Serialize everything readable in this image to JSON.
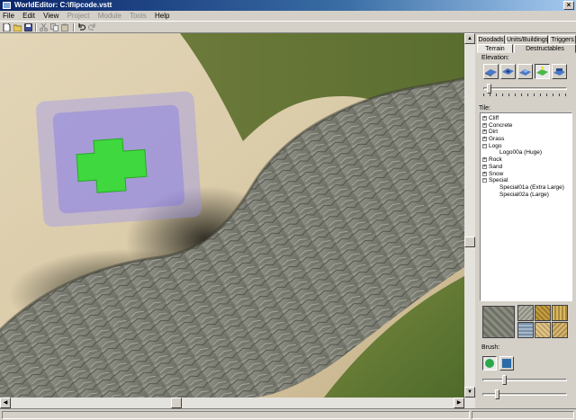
{
  "window": {
    "title": "WorldEditor: C:\\flipcode.vstt",
    "close_glyph": "×"
  },
  "menu": [
    {
      "label": "File",
      "enabled": true
    },
    {
      "label": "Edit",
      "enabled": true
    },
    {
      "label": "View",
      "enabled": true
    },
    {
      "label": "Project",
      "enabled": false
    },
    {
      "label": "Module",
      "enabled": false
    },
    {
      "label": "Tools",
      "enabled": false
    },
    {
      "label": "Help",
      "enabled": true
    }
  ],
  "toolbar": {
    "buttons": [
      "new-file-icon",
      "open-folder-icon",
      "save-icon",
      "cut-icon",
      "copy-icon",
      "paste-icon",
      "undo-icon",
      "redo-icon"
    ]
  },
  "tabs": {
    "row1": [
      "Doodads",
      "Units/Buildings",
      "Triggers"
    ],
    "row2": [
      "Terrain",
      "Destructables"
    ],
    "active": "Terrain"
  },
  "elevation": {
    "label": "Elevation:",
    "selected_index": 3,
    "slider_level": 0.05
  },
  "tiles": {
    "label": "Tile:",
    "tree": [
      {
        "label": "Cliff",
        "type": "parent",
        "expanded": false
      },
      {
        "label": "Concrete",
        "type": "parent",
        "expanded": false
      },
      {
        "label": "Dirt",
        "type": "parent",
        "expanded": false
      },
      {
        "label": "Grass",
        "type": "parent",
        "expanded": false
      },
      {
        "label": "Logo",
        "type": "parent",
        "expanded": true
      },
      {
        "label": "Logo00a (Huge)",
        "type": "child"
      },
      {
        "label": "Rock",
        "type": "parent",
        "expanded": false
      },
      {
        "label": "Sand",
        "type": "parent",
        "expanded": false
      },
      {
        "label": "Snow",
        "type": "parent",
        "expanded": false
      },
      {
        "label": "Special",
        "type": "parent",
        "expanded": true
      },
      {
        "label": "Special01a (Extra Large)",
        "type": "child"
      },
      {
        "label": "Special02a (Large)",
        "type": "child"
      }
    ]
  },
  "brush": {
    "label": "Brush:",
    "selected": "circle-brush"
  },
  "colors": {
    "titlebar": "#0a246a",
    "selection_green": "#3fd83f",
    "selection_blue": "#7a72ee"
  }
}
